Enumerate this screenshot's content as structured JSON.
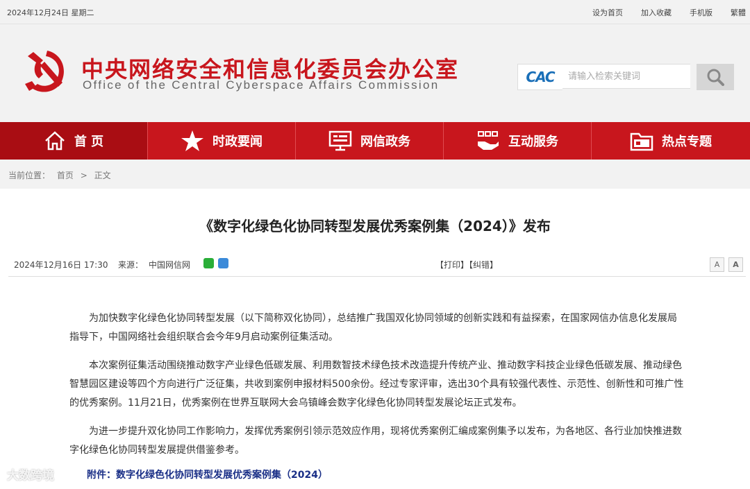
{
  "topbar": {
    "date": "2024年12月24日 星期二",
    "links": [
      "设为首页",
      "加入收藏",
      "手机版",
      "繁體"
    ]
  },
  "header": {
    "cn_title": "中央网络安全和信息化委员会办公室",
    "en_title": "Office of the Central Cyberspace Affairs Commission",
    "search_logo": "CAC",
    "search_placeholder": "请输入检索关键词"
  },
  "nav": {
    "items": [
      {
        "label": "首 页",
        "icon": "home-icon"
      },
      {
        "label": "时政要闻",
        "icon": "star-icon"
      },
      {
        "label": "网信政务",
        "icon": "monitor-icon"
      },
      {
        "label": "互动服务",
        "icon": "handshake-icon"
      },
      {
        "label": "热点专题",
        "icon": "folder-icon"
      }
    ]
  },
  "breadcrumb": {
    "prefix": "当前位置：",
    "home": "首页",
    "sep": ">",
    "current": "正文"
  },
  "article": {
    "title": "《数字化绿色化协同转型发展优秀案例集（2024）》发布",
    "date": "2024年12月16日 17:30",
    "source_label": "来源：",
    "source": "中国网信网",
    "tools": "【打印】【纠错】",
    "font_small": "A",
    "font_large": "A",
    "paragraphs": [
      "为加快数字化绿色化协同转型发展（以下简称双化协同），总结推广我国双化协同领域的创新实践和有益探索，在国家网信办信息化发展局指导下，中国网络社会组织联合会今年9月启动案例征集活动。",
      "本次案例征集活动围绕推动数字产业绿色低碳发展、利用数智技术绿色技术改造提升传统产业、推动数字科技企业绿色低碳发展、推动绿色智慧园区建设等四个方向进行广泛征集，共收到案例申报材料500余份。经过专家评审，选出30个具有较强代表性、示范性、创新性和可推广性的优秀案例。11月21日，优秀案例在世界互联网大会乌镇峰会数字化绿色化协同转型发展论坛正式发布。",
      "为进一步提升双化协同工作影响力，发挥优秀案例引领示范效应作用，现将优秀案例汇编成案例集予以发布，为各地区、各行业加快推进数字化绿色化协同转型发展提供借鉴参考。"
    ],
    "attachment": "附件：数字化绿色化协同转型发展优秀案例集（2024）"
  },
  "watermark": "大数跨境",
  "colors": {
    "brand_red": "#c8161d",
    "nav_active": "#a90d13",
    "attachment_blue": "#1a2f87"
  }
}
